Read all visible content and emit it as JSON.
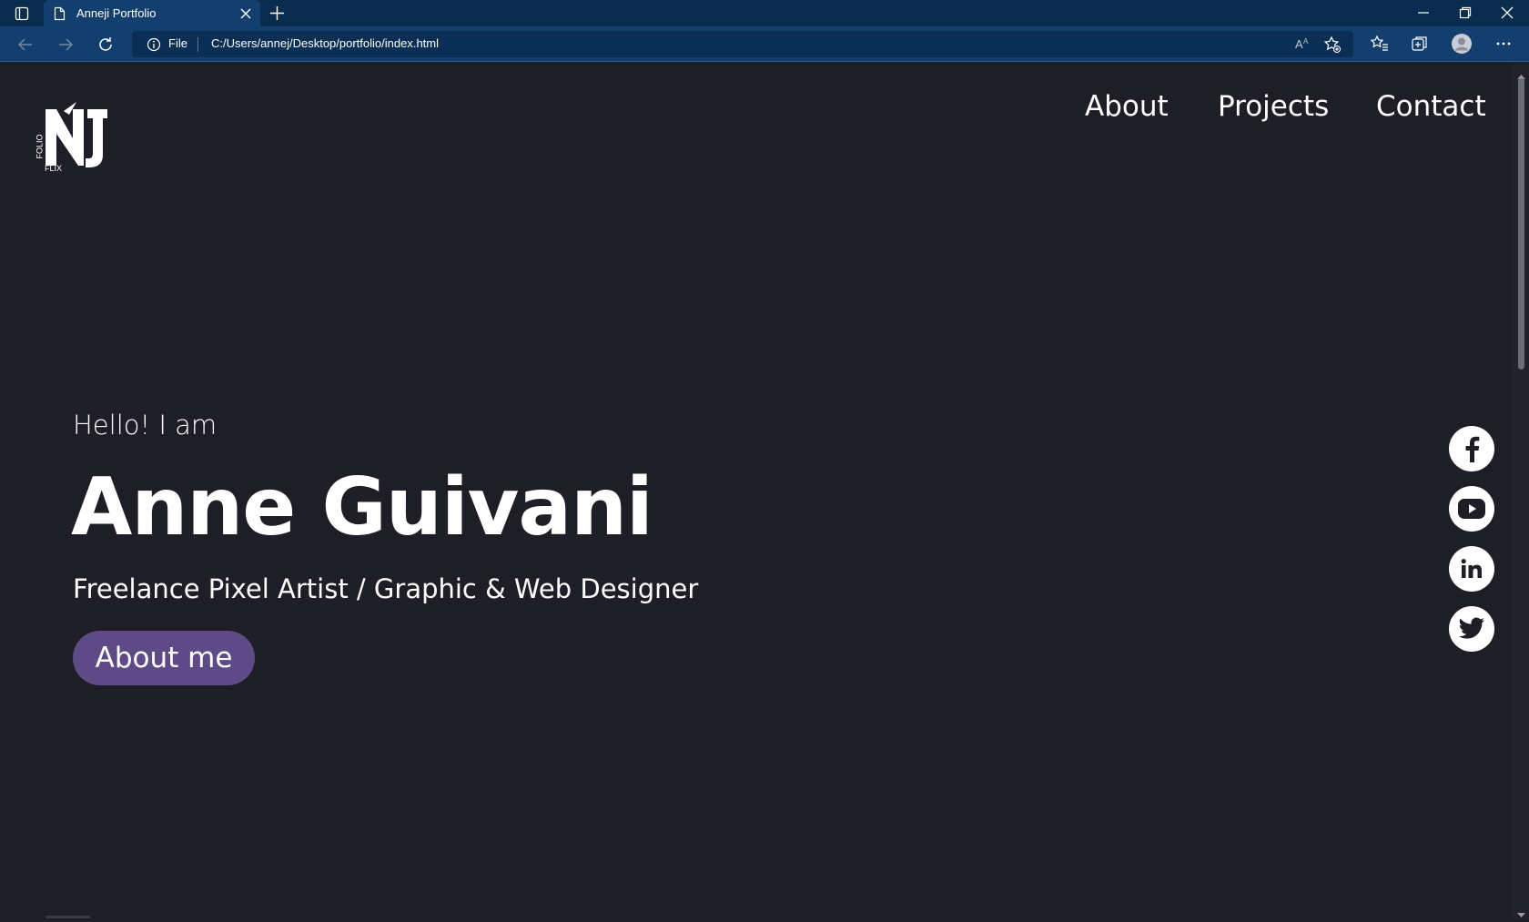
{
  "browser": {
    "tab_title": "Anneji Portfolio",
    "address_scheme_label": "File",
    "address_url": "C:/Users/annej/Desktop/portfolio/index.html",
    "icons": [
      "tab-actions-icon",
      "page-icon",
      "close-icon",
      "plus-icon",
      "back-arrow-icon",
      "forward-arrow-icon",
      "refresh-icon",
      "info-icon",
      "read-aloud-icon",
      "add-favorite-icon",
      "favorites-icon",
      "collections-icon",
      "profile-icon",
      "more-icon",
      "minimize-icon",
      "restore-icon",
      "close-window-icon"
    ]
  },
  "site": {
    "logo": {
      "side_text": "FOLIO",
      "bottom_text": "FLIX"
    },
    "nav": {
      "about": "About",
      "projects": "Projects",
      "contact": "Contact"
    },
    "hero": {
      "greeting": "Hello! I am",
      "name": "Anne Guivani",
      "role": "Freelance Pixel Artist / Graphic & Web Designer",
      "cta": "About me"
    },
    "social": [
      "facebook-icon",
      "youtube-icon",
      "linkedin-icon",
      "twitter-icon"
    ],
    "colors": {
      "background": "#1e1e26",
      "accent": "#5e4a86",
      "text": "#ffffff",
      "chrome": "#123f6d"
    }
  }
}
